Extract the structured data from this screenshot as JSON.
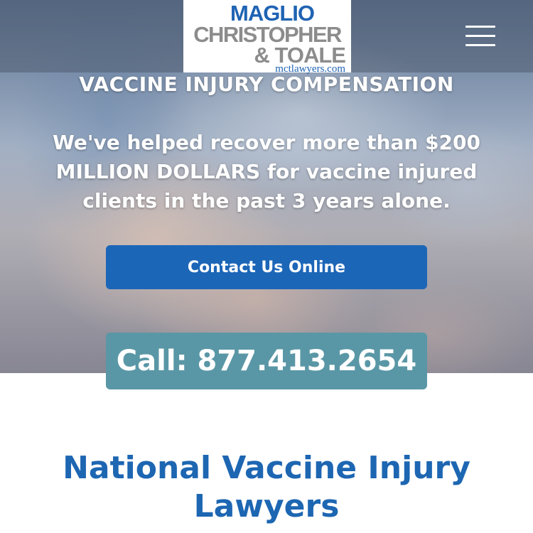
{
  "header": {
    "logo": {
      "line1": "MAGLIO",
      "line2": "CHRISTOPHER",
      "line3": "& TOALE",
      "url": "mctlawyers.com"
    },
    "menu_icon": "hamburger-menu-icon"
  },
  "hero": {
    "title": "VACCINE INJURY COMPENSATION",
    "text": "We've helped recover more than $200 MILLION DOLLARS for vaccine injured clients in the past 3 years alone.",
    "contact_button_label": "Contact Us Online",
    "call_button_label": "Call: 877.413.2654"
  },
  "section": {
    "title": "National Vaccine Injury Lawyers"
  },
  "colors": {
    "brand_blue": "#1c66b8",
    "call_teal": "#5a97a6",
    "logo_gray": "#8c8c8c"
  }
}
